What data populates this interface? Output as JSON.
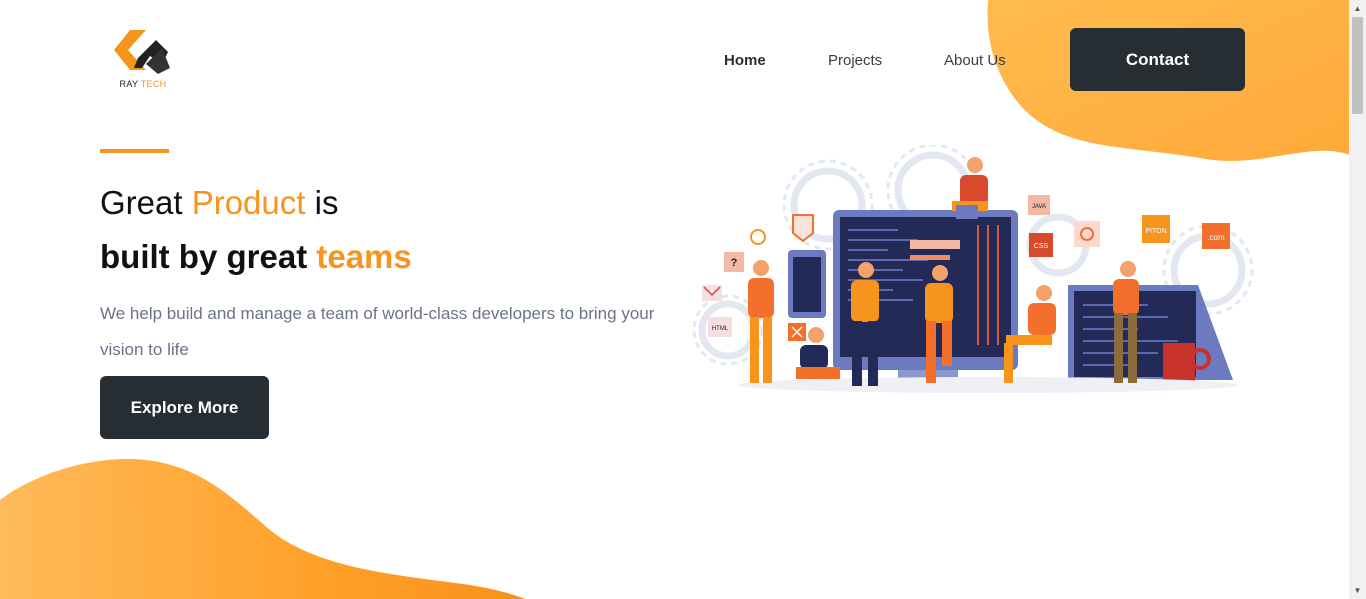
{
  "colors": {
    "accent": "#f7941d",
    "dark_button": "#262d33",
    "blob_light": "#ffb648",
    "text_muted": "#6b7385"
  },
  "brand": {
    "logo_icon": "raytech-logo-icon",
    "name_part1": "RAY",
    "name_part2": "TECH"
  },
  "nav": {
    "home": "Home",
    "projects": "Projects",
    "about": "About Us",
    "contact": "Contact"
  },
  "hero": {
    "line1_a": "Great ",
    "line1_highlight": "Product",
    "line1_b": " is",
    "line2_a": "built by great ",
    "line2_highlight": "teams",
    "description": "We help build and manage a team of world-class developers to bring your vision to life",
    "cta": "Explore More"
  },
  "illustration": {
    "tags": [
      "?",
      "HTML",
      "JAVA",
      "CSS",
      "PITON",
      ".com"
    ]
  }
}
